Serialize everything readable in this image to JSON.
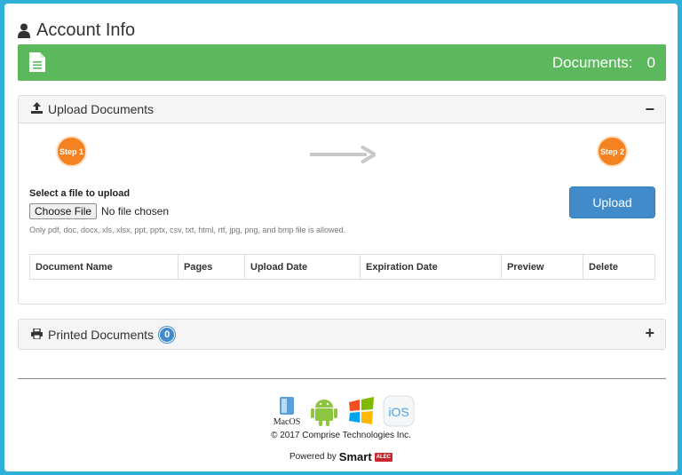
{
  "header": {
    "title": "Account Info",
    "icon": "user-icon"
  },
  "summary_bar": {
    "label": "Documents:",
    "count": "0",
    "color": "#5cb85c"
  },
  "upload_panel": {
    "title": "Upload Documents",
    "toggle": "−",
    "step1": "Step 1",
    "step2": "Step 2",
    "select_label": "Select a file to upload",
    "choose_button": "Choose File",
    "no_file": "No file chosen",
    "allowed_note": "Only pdf, doc, docx, xls, xlsx, ppt, pptx, csv, txt, html, rtf, jpg, png, and bmp file is allowed.",
    "upload_button": "Upload",
    "table_headers": [
      "Document Name",
      "Pages",
      "Upload Date",
      "Expiration Date",
      "Preview",
      "Delete"
    ]
  },
  "printed_panel": {
    "title": "Printed Documents",
    "count": "0",
    "toggle": "+"
  },
  "footer": {
    "os_icons": [
      "macos-icon",
      "android-icon",
      "windows-icon",
      "ios-icon"
    ],
    "macos_label": "MacOS",
    "ios_label": "iOS",
    "copyright": "© 2017 Comprise Technologies Inc.",
    "powered_by": "Powered by",
    "brand_smart": "Smart",
    "brand_alec": "ALEC"
  },
  "colors": {
    "background": "#2eb0d8",
    "step": "#f58220",
    "primary": "#428bca"
  }
}
